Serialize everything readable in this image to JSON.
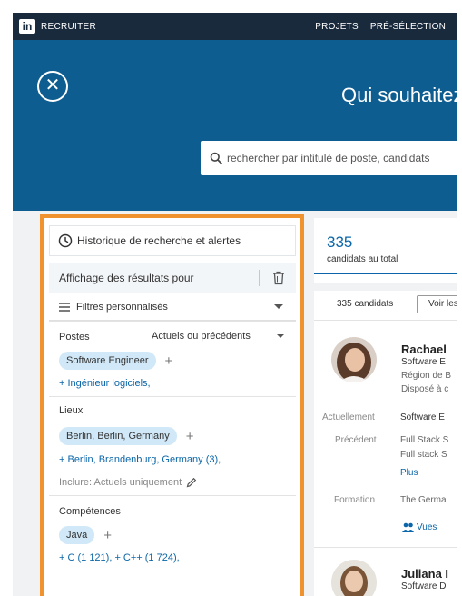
{
  "app": {
    "logo_text": "in",
    "product_name": "RECRUITER",
    "nav": [
      "PROJETS",
      "PRÉ-SÉLECTION"
    ]
  },
  "hero": {
    "title": "Qui souhaitez-vous trouver ?",
    "search_placeholder": "rechercher par intitulé de poste, candidats"
  },
  "filters": {
    "history_label": "Historique de recherche et alertes",
    "results_for_label": "Affichage des résultats pour",
    "custom_filters_label": "Filtres personnalisés",
    "sections": [
      {
        "title": "Postes",
        "select_value": "Actuels ou précédents",
        "pill": "Software Engineer",
        "suggestion": "+ Ingénieur logiciels,"
      },
      {
        "title": "Lieux",
        "pill": "Berlin, Berlin, Germany",
        "suggestion": "+ Berlin, Brandenburg, Germany (3),",
        "include_label": "Inclure: Actuels uniquement"
      },
      {
        "title": "Compétences",
        "pill": "Java",
        "suggestion": "+ C (1 121), + C++ (1 724),"
      }
    ]
  },
  "results": {
    "total": "335",
    "total_label": "candidats au total",
    "candidates_count": "335 candidats",
    "view_button": "Voir les",
    "candidates": [
      {
        "name": "Rachael",
        "headline": "Software E",
        "region": "Région de B",
        "availability": "Disposé à c",
        "current_label": "Actuellement",
        "current_value": "Software E",
        "previous_label": "Précédent",
        "previous_values": [
          "Full Stack S",
          "Full stack S"
        ],
        "more_link": "Plus",
        "education_label": "Formation",
        "education_value": "The Germa",
        "views_link": "Vues"
      },
      {
        "name": "Juliana I",
        "headline": "Software D"
      }
    ]
  },
  "colors": {
    "nav_bg": "#1a2a3d",
    "hero_bg": "#0d5d91",
    "accent_orange": "#f0922e",
    "link_blue": "#0a66a8",
    "pill_bg": "#d0e8f7"
  }
}
